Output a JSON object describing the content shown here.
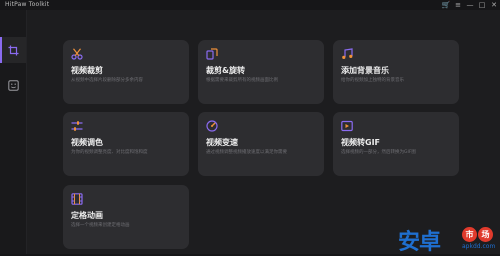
{
  "app": {
    "title": "HitPaw Toolkit",
    "controls": [
      "🛒",
      "≡",
      "—",
      "□",
      "✕"
    ]
  },
  "colors": {
    "accent": "#8a6bf0",
    "icon_orange": "#f0913a",
    "icon_purple": "#8a6bf0"
  },
  "sidebar": {
    "items": [
      {
        "icon": "crop-icon",
        "active": true
      },
      {
        "icon": "face-icon",
        "active": false
      }
    ]
  },
  "cards": [
    {
      "title": "视频裁剪",
      "desc": "从视频中选择片段删除部分多余内容",
      "icon": "scissors-icon"
    },
    {
      "title": "裁剪&旋转",
      "desc": "根据需要来裁剪所有的视频画面比例",
      "icon": "crop-rotate-icon"
    },
    {
      "title": "添加背景音乐",
      "desc": "给你的视频加上独特的背景音乐",
      "icon": "music-icon"
    },
    {
      "title": "视频调色",
      "desc": "为你的视频调整亮度、对比度和饱和度",
      "icon": "sliders-icon"
    },
    {
      "title": "视频变速",
      "desc": "通过视频调整视频播放速度以满足你需要",
      "icon": "speed-icon"
    },
    {
      "title": "视频转GIF",
      "desc": "选择视频的一部分，然后转换为GIF图",
      "icon": "gif-icon"
    },
    {
      "title": "定格动画",
      "desc": "选择一个视频来创建定格动画",
      "icon": "film-icon"
    }
  ],
  "watermark": {
    "text": "安卓",
    "badge1": "市",
    "badge2": "场",
    "domain": "apkdd.com"
  }
}
